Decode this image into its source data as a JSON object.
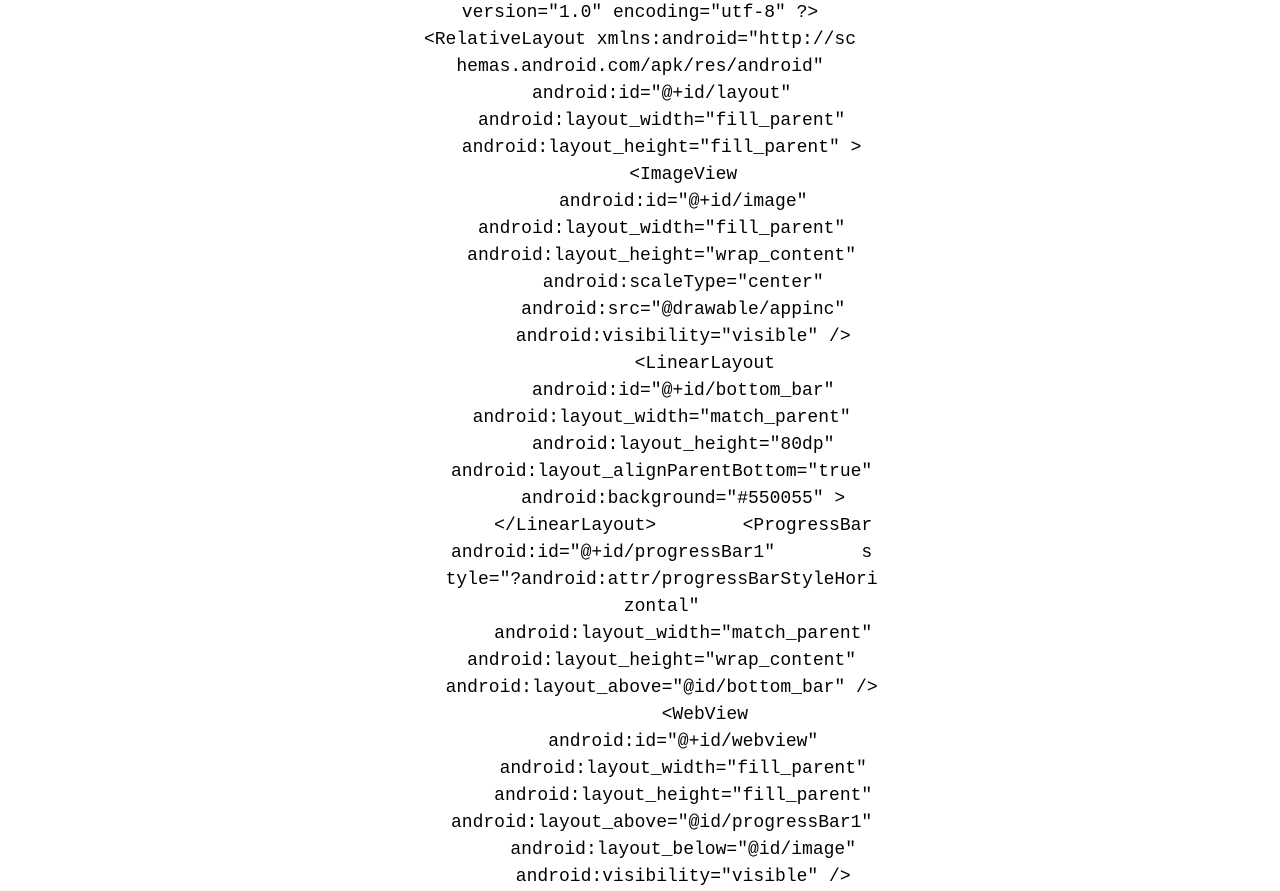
{
  "code": {
    "lines": [
      "version=\"1.0\" encoding=\"utf-8\" ?>",
      "<RelativeLayout xmlns:android=\"http://sc",
      "hemas.android.com/apk/res/android\"",
      "    android:id=\"@+id/layout\"",
      "    android:layout_width=\"fill_parent\"",
      "    android:layout_height=\"fill_parent\" >",
      "        <ImageView",
      "        android:id=\"@+id/image\"",
      "    android:layout_width=\"fill_parent\"",
      "    android:layout_height=\"wrap_content\"",
      "        android:scaleType=\"center\"",
      "        android:src=\"@drawable/appinc\"",
      "        android:visibility=\"visible\" />",
      "            <LinearLayout",
      "        android:id=\"@+id/bottom_bar\"",
      "    android:layout_width=\"match_parent\"",
      "        android:layout_height=\"80dp\"",
      "    android:layout_alignParentBottom=\"true\"",
      "        android:background=\"#550055\" >",
      "        </LinearLayout>        <ProgressBar",
      "    android:id=\"@+id/progressBar1\"        s",
      "    tyle=\"?android:attr/progressBarStyleHori",
      "    zontal\"",
      "        android:layout_width=\"match_parent\"",
      "    android:layout_height=\"wrap_content\"",
      "    android:layout_above=\"@id/bottom_bar\" />",
      "            <WebView",
      "        android:id=\"@+id/webview\"",
      "        android:layout_width=\"fill_parent\"",
      "        android:layout_height=\"fill_parent\"",
      "    android:layout_above=\"@id/progressBar1\"",
      "        android:layout_below=\"@id/image\"",
      "        android:visibility=\"visible\" />"
    ]
  }
}
